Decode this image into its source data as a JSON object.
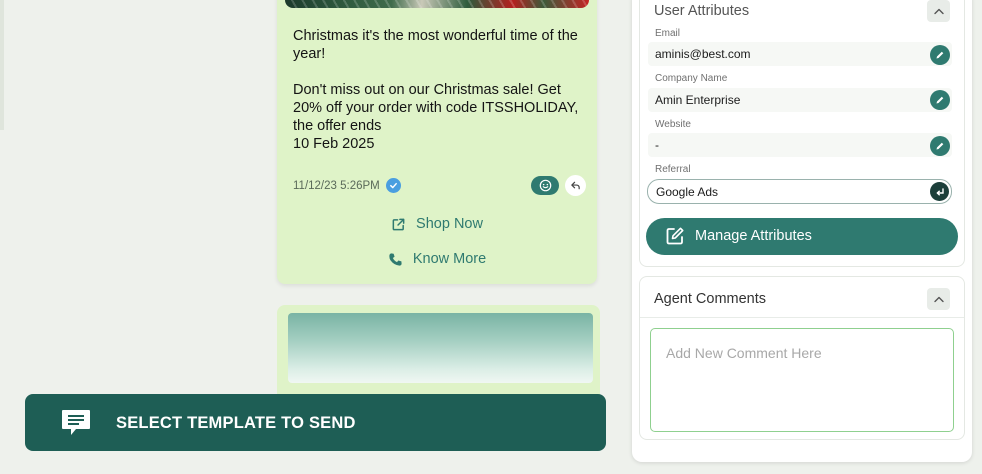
{
  "message": {
    "body": "Christmas it's the most wonderful time of the year!\n\nDon't miss out on our Christmas sale! Get 20% off your order with code ITSSHOLIDAY, the offer ends\n10 Feb 2025",
    "timestamp": "11/12/23 5:26PM",
    "cta_shop": "Shop Now",
    "cta_know": "Know More"
  },
  "template_bar": {
    "label": "SELECT TEMPLATE TO SEND"
  },
  "user_attributes": {
    "title": "User Attributes",
    "fields": [
      {
        "label": "Email",
        "value": "aminis@best.com"
      },
      {
        "label": "Company Name",
        "value": "Amin Enterprise"
      },
      {
        "label": "Website",
        "value": "-"
      },
      {
        "label": "Referral",
        "value": "Google Ads"
      }
    ],
    "manage_label": "Manage Attributes"
  },
  "agent_comments": {
    "title": "Agent Comments",
    "placeholder": "Add New Comment Here"
  },
  "colors": {
    "accent": "#2f7a70",
    "template_bar": "#1e5e55",
    "bubble": "#dff3c8",
    "verified": "#4a9ee0"
  }
}
